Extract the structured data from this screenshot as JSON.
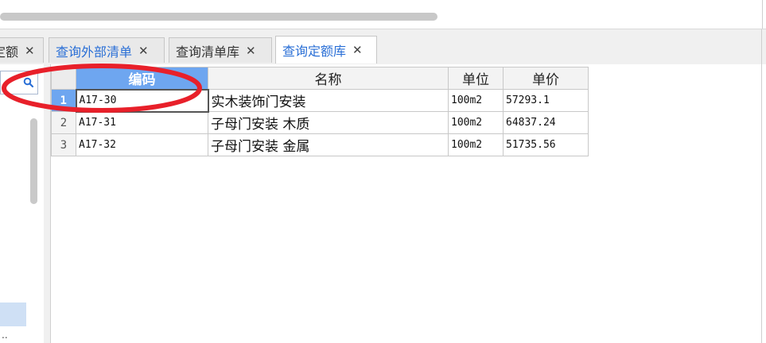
{
  "tabs": [
    {
      "label": "定额",
      "close": "✕",
      "state": "partial"
    },
    {
      "label": "查询外部清单",
      "close": "✕",
      "state": "blue"
    },
    {
      "label": "查询清单库",
      "close": "✕",
      "state": "normal"
    },
    {
      "label": "查询定额库",
      "close": "✕",
      "state": "active"
    }
  ],
  "left_panel": {
    "search_icon": "search-icon",
    "more_text": ".."
  },
  "grid": {
    "columns": [
      "编码",
      "名称",
      "单位",
      "单价"
    ],
    "rows": [
      {
        "num": "1",
        "code": "A17-30",
        "name": "实木装饰门安装",
        "unit": "100m2",
        "price": "57293.1"
      },
      {
        "num": "2",
        "code": "A17-31",
        "name": "子母门安装 木质",
        "unit": "100m2",
        "price": "64837.24"
      },
      {
        "num": "3",
        "code": "A17-32",
        "name": "子母门安装 金属",
        "unit": "100m2",
        "price": "51735.56"
      }
    ]
  },
  "colors": {
    "accent": "#2a6fd6",
    "header_selected": "#6ea6f0",
    "annotation": "#e8202a"
  }
}
